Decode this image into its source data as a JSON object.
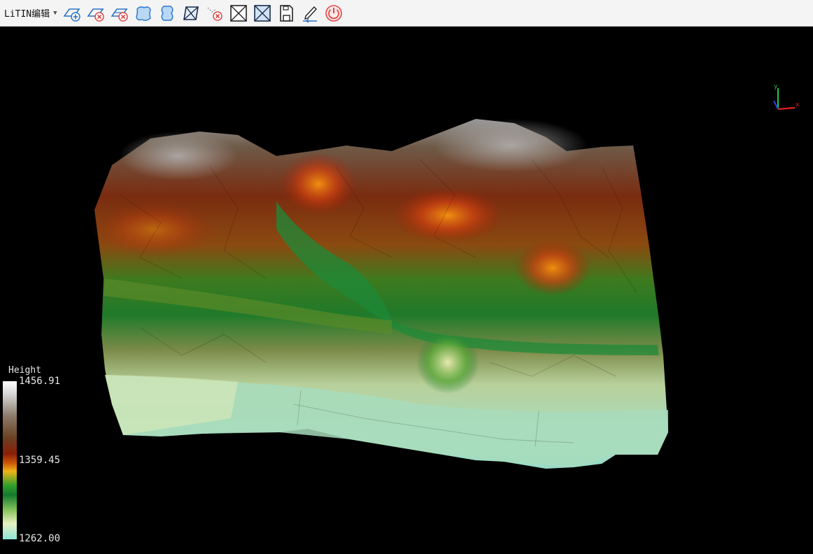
{
  "toolbar": {
    "title": "LiTIN编辑",
    "buttons": [
      {
        "name": "add-triangle-icon"
      },
      {
        "name": "delete-triangle-icon"
      },
      {
        "name": "delete-triangle-alt-icon"
      },
      {
        "name": "polygon-region-icon"
      },
      {
        "name": "bracket-region-icon"
      },
      {
        "name": "edge-swap-icon"
      },
      {
        "name": "delete-point-icon"
      },
      {
        "name": "crossed-box-icon"
      },
      {
        "name": "crossed-box-blue-icon"
      },
      {
        "name": "save-icon"
      },
      {
        "name": "edit-undo-icon"
      },
      {
        "name": "power-exit-icon"
      }
    ]
  },
  "axis": {
    "x": "x",
    "y": "y"
  },
  "legend": {
    "title": "Height",
    "max": "1456.91",
    "mid": "1359.45",
    "min": "1262.00"
  },
  "colors": {
    "background": "#000000",
    "toolbar_bg": "#f4f4f4",
    "icon_blue": "#2a74c8",
    "icon_red": "#e04848"
  }
}
